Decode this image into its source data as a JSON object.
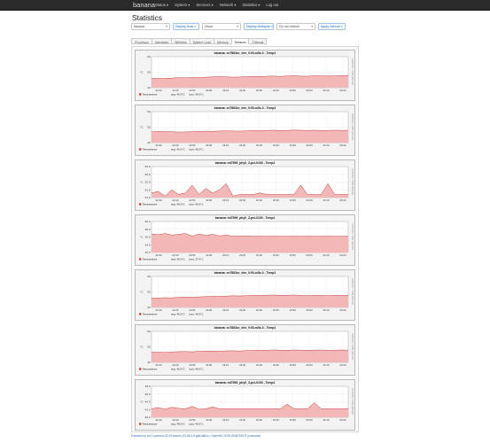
{
  "header": {
    "brand": "banana",
    "nav": [
      "Status ▾",
      "System ▾",
      "Services ▾",
      "Network ▾",
      "Statistics ▾",
      "Log out"
    ]
  },
  "page": {
    "title": "Statistics"
  },
  "controls": {
    "host_select": "banana",
    "display_host_btn": "Display Host »",
    "time_select": "2hour",
    "display_timespan_btn": "Display timespan »",
    "refresh_select": "Do not refresh",
    "apply_interval_btn": "Apply interval »"
  },
  "tabs": [
    "Processor",
    "Interfaces",
    "Wireless",
    "System Load",
    "Memory",
    "Sensors",
    "Thermal"
  ],
  "active_tab": "Sensors",
  "graph_common": {
    "x_ticks": [
      "22:30",
      "22:40",
      "22:50",
      "23:00",
      "23:10",
      "23:20",
      "23:30",
      "23:40",
      "23:50",
      "00:00",
      "00:10",
      "00:20"
    ],
    "legend_label": "Temperature"
  },
  "graphs": [
    {
      "title": "banana: ec7863zc_dev_0:00-m5z-0 - Temp1",
      "avg": "avg: 46.0°C",
      "last": "Last: 46.0°C",
      "y_ticks": [
        "60",
        "50",
        "40"
      ],
      "series": [
        46,
        46,
        46,
        46.2,
        46.5,
        46.4,
        46.6,
        46.5,
        46.8,
        47,
        47.2,
        47,
        46.8,
        46.9,
        47.1,
        47.3,
        47.2,
        47.4,
        47.5,
        47.3,
        47.6,
        47.8,
        47.5,
        47.4,
        47.7,
        47.6,
        47.5,
        47.6,
        47.8,
        47.7
      ]
    },
    {
      "title": "banana: ec7863zc_dev_0:00-m5z-0 - Temp1",
      "avg": "avg: 46.0°C",
      "last": "Last: 46.5°C",
      "y_ticks": [
        "60",
        "50",
        "40"
      ],
      "series": [
        47,
        47.2,
        47.1,
        47,
        46.8,
        46.9,
        47.1,
        47.2,
        47.4,
        47.3,
        47.5,
        47.6,
        47.5,
        47.4,
        47.6,
        47.8,
        47.7,
        47.9,
        48,
        47.8,
        47.9,
        48.1,
        48,
        47.9,
        48,
        47.8,
        47.9,
        48,
        47.9,
        48
      ]
    },
    {
      "title": "banana: mt7596_phy0_2-pci-0100 - Temp1",
      "avg": "avg: 46.0°C",
      "last": "Last: 46.0°C",
      "y_ticks": [
        "53.0",
        "52.5",
        "52.0",
        "51.5",
        "51.0"
      ],
      "series": [
        51.3,
        51.4,
        51.1,
        51.5,
        51.2,
        51.3,
        51.8,
        51.2,
        51.6,
        51.3,
        51.5,
        51.9,
        51.1,
        51.2,
        51.2,
        51.2,
        51.3,
        51.2,
        51.2,
        51.2,
        51.2,
        51.2,
        51.8,
        51.2,
        51.2,
        51.2,
        51.9,
        51.2,
        51.2,
        51.2
      ]
    },
    {
      "title": "banana: mt7596_phy0_2-pci-0100 - Temp1",
      "avg": "avg: 46.0°C",
      "last": "Last: 37.6°C",
      "y_ticks": [
        "40.0",
        "38.0",
        "36.0",
        "34.0",
        "32.0"
      ],
      "series": [
        36.8,
        36.6,
        36.9,
        36.5,
        36.7,
        36.9,
        36.2,
        36.8,
        36.4,
        36.7,
        36.3,
        36.5,
        36.2,
        36.2,
        36.3,
        36.2,
        36.2,
        36.2,
        36.2,
        36.2,
        36.2,
        36.2,
        36.2,
        36.2,
        36.2,
        36.2,
        36.2,
        36.2,
        36.2,
        36.2
      ]
    },
    {
      "title": "banana: ec7863zc_dev_0:00-m5z-0 - Temp1",
      "avg": "avg: 46.0°C",
      "last": "Last: 46.0°C",
      "y_ticks": [
        "60",
        "50",
        "40"
      ],
      "series": [
        46,
        46.1,
        46.3,
        46.2,
        46.5,
        46.7,
        46.6,
        46.8,
        47,
        47.2,
        47.1,
        47.3,
        47.5,
        47.4,
        47.6,
        47.8,
        47.7,
        47.9,
        48,
        47.8,
        47.9,
        48,
        47.8,
        47.6,
        47.8,
        47.7,
        47.6,
        47.8,
        47.7,
        47.8
      ]
    },
    {
      "title": "banana: ec7863zc_dev_0:00-m5z-0 - Temp1",
      "avg": "avg: 46.0°C",
      "last": "Last: 46.0°C",
      "y_ticks": [
        "60",
        "50",
        "40"
      ],
      "series": [
        46.5,
        46.6,
        46.4,
        46.7,
        46.9,
        47,
        46.8,
        47.1,
        47.2,
        47.3,
        47.1,
        47.4,
        47.5,
        47.3,
        47.6,
        47.7,
        47.9,
        47.8,
        48,
        47.9,
        47.8,
        48,
        47.9,
        47.8,
        47.9,
        48,
        47.8,
        47.9,
        48,
        47.9
      ]
    },
    {
      "title": "banana: mt7596_phy0_3-pci-0100 - Temp1",
      "avg": "avg: 46.0°C",
      "last": "Last: 46.0°C",
      "y_ticks": [
        "48.0",
        "46.0",
        "44.0",
        "42.0",
        "40.0"
      ],
      "series": [
        42.2,
        42.5,
        42.1,
        42.6,
        42.3,
        42.2,
        42.8,
        42.1,
        42.2,
        42.7,
        42.2,
        42.2,
        42.2,
        42.2,
        42.2,
        42.2,
        42.2,
        42.2,
        42.2,
        42.2,
        43.4,
        42.2,
        42.2,
        42.2,
        43.8,
        42.2,
        42.2,
        42.2,
        42.2,
        42.2
      ]
    }
  ],
  "footer": {
    "text": "Powered by LuCI openwrt-23.05 branch (23.05.3-8-gdb1a8cc) / OpenWrt 23.05-SNAPSHOT (unknown)"
  },
  "colors": {
    "fill": "#f4b7b7",
    "line": "#c4413e",
    "grid": "#cfcfcf",
    "plot_bg": "#ffffff"
  }
}
